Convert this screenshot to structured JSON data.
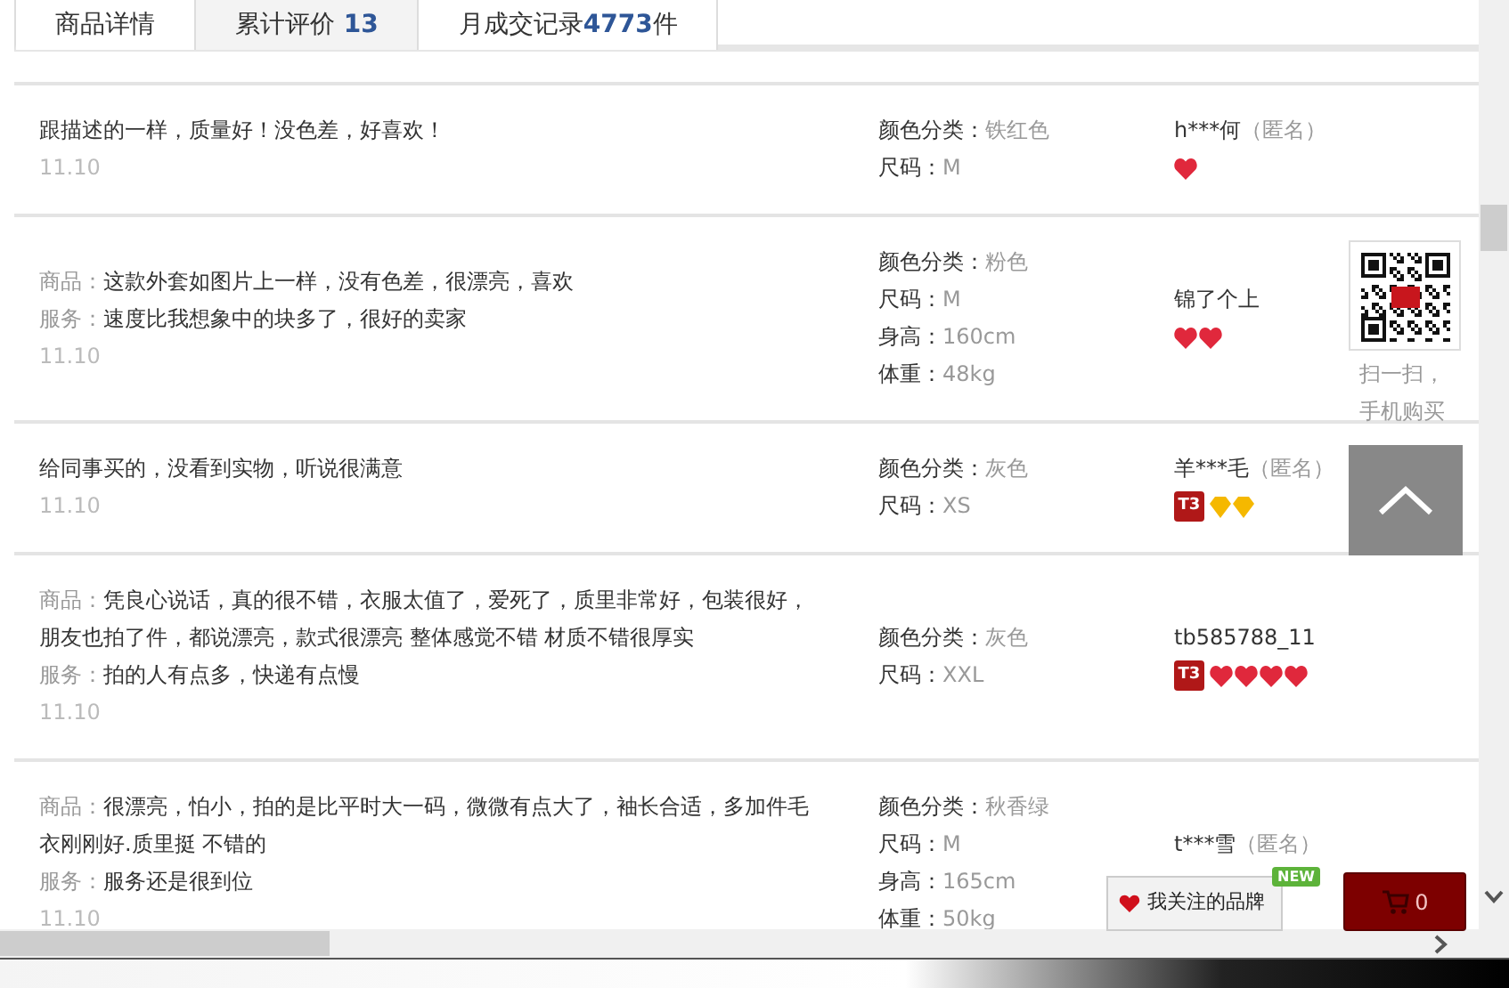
{
  "tabs": [
    {
      "label": "商品详情",
      "selected": false
    },
    {
      "label": "累计评价",
      "count": "13",
      "selected": true
    },
    {
      "label": "月成交记录",
      "count": "4773",
      "suffix": "件",
      "selected": false
    }
  ],
  "reviews": [
    {
      "comment": [
        {
          "text": "跟描述的一样，质量好！没色差，好喜欢！"
        }
      ],
      "date": "11.10",
      "specs": [
        {
          "label": "颜色分类：",
          "value": "铁红色"
        },
        {
          "label": "尺码：",
          "value": "M"
        }
      ],
      "user": {
        "name": "h***何",
        "anonymous": "（匿名）"
      },
      "rank": {
        "icons": [
          {
            "kind": "heart"
          }
        ]
      }
    },
    {
      "comment": [
        {
          "label": "商品：",
          "text": "这款外套如图片上一样，没有色差，很漂亮，喜欢"
        },
        {
          "label": "服务：",
          "text": "速度比我想象中的块多了，很好的卖家"
        }
      ],
      "date": "11.10",
      "specs": [
        {
          "label": "颜色分类：",
          "value": "粉色"
        },
        {
          "label": "尺码：",
          "value": "M"
        },
        {
          "label": "身高：",
          "value": "160cm"
        },
        {
          "label": "体重：",
          "value": "48kg"
        }
      ],
      "user": {
        "name": "锦了个上"
      },
      "rank": {
        "icons": [
          {
            "kind": "heart"
          },
          {
            "kind": "heart"
          }
        ]
      }
    },
    {
      "comment": [
        {
          "text": "给同事买的，没看到实物，听说很满意"
        }
      ],
      "date": "11.10",
      "specs": [
        {
          "label": "颜色分类：",
          "value": "灰色"
        },
        {
          "label": "尺码：",
          "value": "XS"
        }
      ],
      "user": {
        "name": "羊***毛",
        "anonymous": "（匿名）"
      },
      "rank": {
        "badge": "T3",
        "icons": [
          {
            "kind": "diamond"
          },
          {
            "kind": "diamond"
          }
        ]
      }
    },
    {
      "comment": [
        {
          "label": "商品：",
          "text": "凭良心说话，真的很不错，衣服太值了，爱死了，质里非常好，包装很好，朋友也拍了件，都说漂亮，款式很漂亮 整体感觉不错 材质不错很厚实"
        },
        {
          "label": "服务：",
          "text": "拍的人有点多，快递有点慢"
        }
      ],
      "date": "11.10",
      "specs": [
        {
          "label": "颜色分类：",
          "value": "灰色"
        },
        {
          "label": "尺码：",
          "value": "XXL"
        }
      ],
      "user": {
        "name": "tb585788_11"
      },
      "rank": {
        "badge": "T3",
        "icons": [
          {
            "kind": "heart"
          },
          {
            "kind": "heart"
          },
          {
            "kind": "heart"
          },
          {
            "kind": "heart"
          }
        ]
      }
    },
    {
      "comment": [
        {
          "label": "商品：",
          "text": "很漂亮，怕小，拍的是比平时大一码，微微有点大了，袖长合适，多加件毛衣刚刚好.质里挺 不错的"
        },
        {
          "label": "服务：",
          "text": "服务还是很到位"
        }
      ],
      "date": "11.10",
      "specs": [
        {
          "label": "颜色分类：",
          "value": "秋香绿"
        },
        {
          "label": "尺码：",
          "value": "M"
        },
        {
          "label": "身高：",
          "value": "165cm"
        },
        {
          "label": "体重：",
          "value": "50kg"
        }
      ],
      "user": {
        "name": "t***雪",
        "anonymous": "（匿名）"
      }
    }
  ],
  "qr": {
    "caption": "扫一扫，手机购买"
  },
  "brand_button": {
    "label": "我关注的品牌",
    "tag": "NEW"
  },
  "cart": {
    "count": "0"
  }
}
